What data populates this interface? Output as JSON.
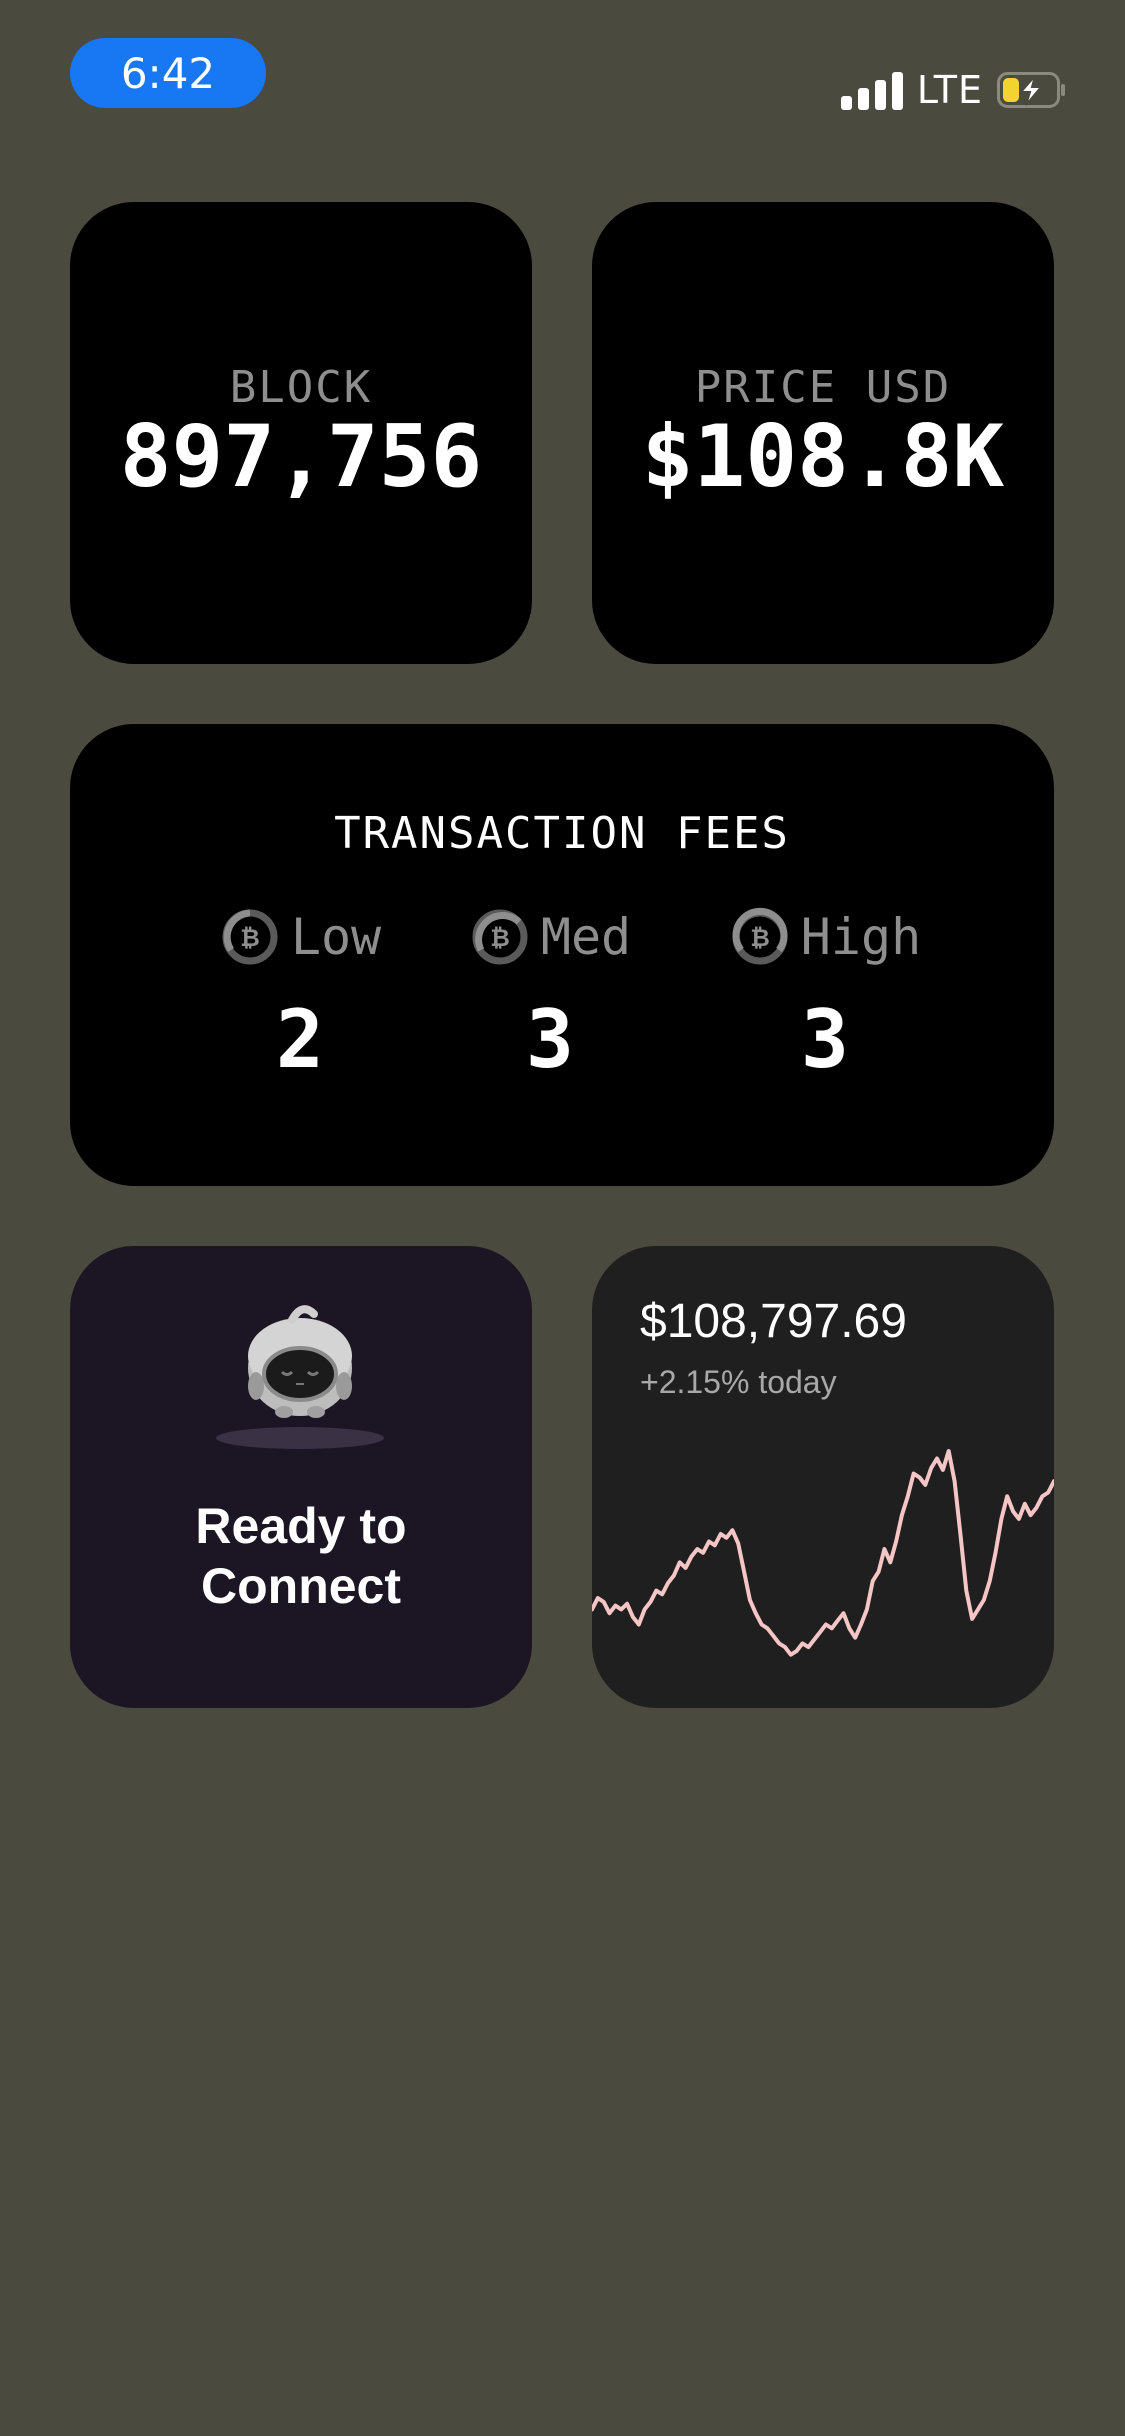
{
  "status_bar": {
    "time": "6:42",
    "network": "LTE"
  },
  "block_widget": {
    "label": "BLOCK",
    "value": "897,756"
  },
  "price_widget": {
    "label": "PRICE USD",
    "value": "$108.8K"
  },
  "fees_widget": {
    "title": "TRANSACTION FEES",
    "tiers": [
      {
        "label": "Low",
        "value": "2"
      },
      {
        "label": "Med",
        "value": "3"
      },
      {
        "label": "High",
        "value": "3"
      }
    ]
  },
  "connect_widget": {
    "line1": "Ready to",
    "line2": "Connect"
  },
  "price_chart_widget": {
    "price": "$108,797.69",
    "change": "+2.15% today",
    "line_color": "#f6c6c6",
    "series": [
      0.3,
      0.36,
      0.34,
      0.28,
      0.32,
      0.3,
      0.33,
      0.26,
      0.22,
      0.3,
      0.34,
      0.4,
      0.38,
      0.44,
      0.48,
      0.55,
      0.52,
      0.58,
      0.62,
      0.6,
      0.66,
      0.64,
      0.7,
      0.68,
      0.72,
      0.65,
      0.5,
      0.35,
      0.28,
      0.22,
      0.2,
      0.16,
      0.12,
      0.1,
      0.06,
      0.08,
      0.12,
      0.1,
      0.14,
      0.18,
      0.22,
      0.2,
      0.24,
      0.28,
      0.2,
      0.15,
      0.22,
      0.3,
      0.45,
      0.5,
      0.62,
      0.55,
      0.66,
      0.8,
      0.9,
      1.02,
      1.0,
      0.96,
      1.05,
      1.1,
      1.04,
      1.14,
      0.98,
      0.7,
      0.4,
      0.25,
      0.3,
      0.35,
      0.45,
      0.6,
      0.78,
      0.9,
      0.82,
      0.78,
      0.86,
      0.8,
      0.84,
      0.9,
      0.92,
      0.98
    ]
  }
}
